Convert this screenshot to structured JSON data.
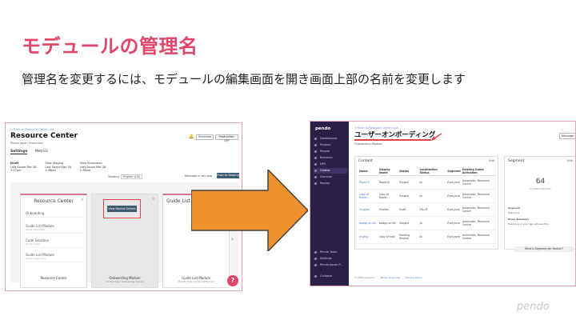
{
  "slide": {
    "title": "モデュールの管理名",
    "subtitle": "管理名を変更するには、モデュールの編集画面を開き画面上部の名前を変更します",
    "footer_logo": "pendo"
  },
  "left_screenshot": {
    "back_link": "< Back to Resource Center List",
    "title": "Resource Center",
    "app_label": "Pendo Japan Production",
    "bell_icon": "bell-icon",
    "schedule_btn": "Schedule",
    "status_btn": "Production: OFF",
    "tabs": [
      "Settings",
      "Metrics"
    ],
    "envs": [
      {
        "name": "Draft",
        "detail": "Last Saved Mar 28 2:37pm"
      },
      {
        "name": "View Staging",
        "detail": "Last Saved Mar 28 2:38pm"
      },
      {
        "name": "View Production",
        "detail": "Last Saved Mar 28 2:38pm"
      }
    ],
    "viewing_label": "Viewing:",
    "viewing_value": "English (US)",
    "message_label": "Message in my app",
    "push_btn": "Push to Staging",
    "card1_title": "Resource Center",
    "card1_items": [
      {
        "label": "Onboarding",
        "detail": ""
      },
      {
        "label": "Guide List Module",
        "detail": "Guide listed here"
      },
      {
        "label": "Code Sandbox",
        "detail": "Guides listed"
      },
      {
        "label": "Guide List Module",
        "detail": "Guides listed here"
      }
    ],
    "view_module_btn": "View Module Details",
    "card3_title": "Guide List Mo",
    "card_labels": [
      {
        "label": "Resource Center",
        "detail": ""
      },
      {
        "label": "Onboarding Module",
        "detail": "Module Type: Onboarding Module"
      },
      {
        "label": "Guide List Module",
        "detail": "Module Type: Guide List Module"
      }
    ],
    "help_glyph": "?"
  },
  "right_screenshot": {
    "logo": "pendo",
    "nav_items": [
      "Dashboards",
      "Product",
      "People",
      "Behavior",
      "NPS",
      "Guides",
      "Discover",
      "Replay"
    ],
    "nav_bottom": [
      "Pendo Tools",
      "Settings",
      "Pendo Japan P...",
      "Collapse"
    ],
    "back_link": "< Back to Resource Center List",
    "page_title": "ユーザーオンボーディング",
    "sub": "Onboarding Module",
    "message_btn": "Message in",
    "content_header": "Content",
    "edit_label": "Edit",
    "table_headers": [
      "Name",
      "Display Name",
      "Status",
      "Localization Status",
      "Segment",
      "Existing Guide Activation"
    ],
    "table_rows": [
      [
        "Rapid B",
        "Rapid B",
        "Staged",
        "JA",
        "Everyone",
        "Automatic, Resource Center"
      ],
      [
        "copy of Rapid...",
        "copy of Rapid...",
        "Staged",
        "JA",
        "Everyone",
        "Automatic, Resource Center"
      ],
      [
        "Insights",
        "Hidden",
        "Draft",
        "EN-US",
        "Everyone",
        "Automatic, Resource Center"
      ],
      [
        "badge on NC",
        "badge on NC",
        "Staged",
        "JA",
        "Everyone",
        "Automatic, Resource Center"
      ],
      [
        "testing",
        "copy of test",
        "Pending Review",
        "JA",
        "Everyone",
        "Automatic, Resource Center"
      ]
    ],
    "segment_header": "Segment",
    "segment_count": "64",
    "segment_count_label": "ELIGIBLE VISITORS",
    "segment_lines": [
      "Segment",
      "Everyone",
      "Rules Summary",
      "Everyone in your app will see this."
    ],
    "segment_btn": "What is Segment per Module?",
    "footer": [
      "© 2024 pendo.io",
      "Terms of Service",
      "Privacy Policy"
    ]
  }
}
